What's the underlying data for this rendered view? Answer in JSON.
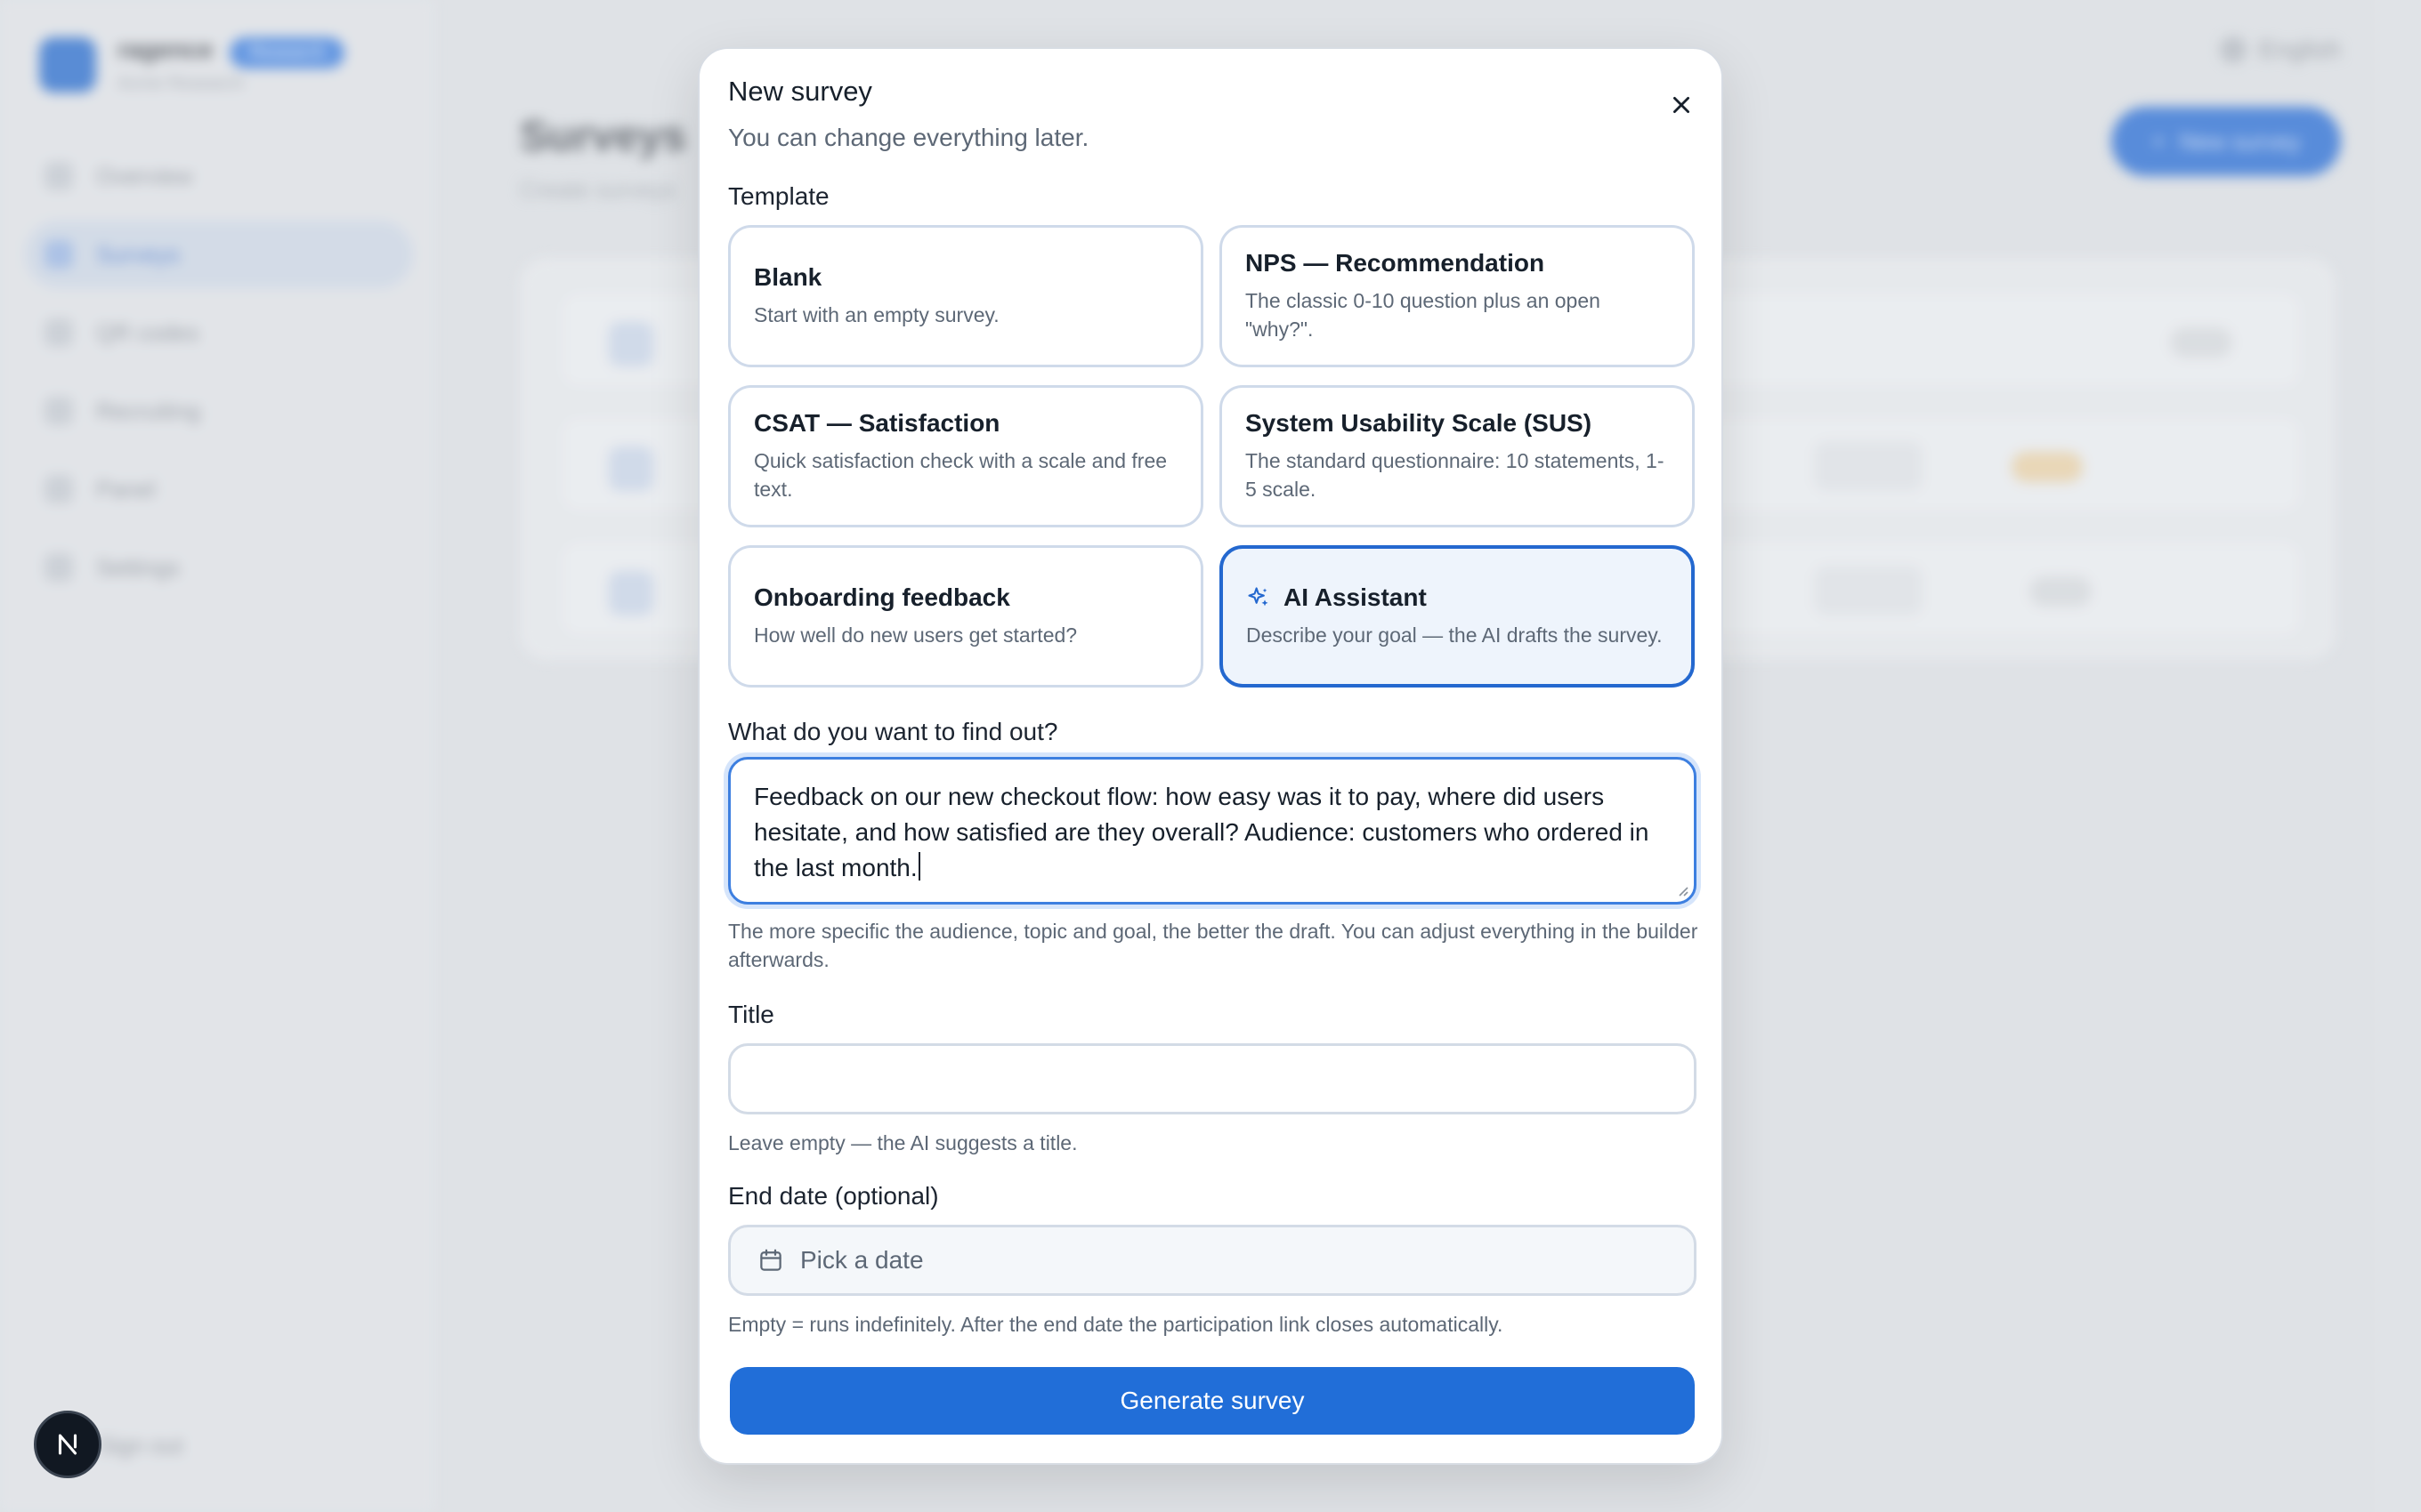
{
  "background": {
    "brand": {
      "name": "ragence",
      "badge": "Research",
      "sub": "Acme Research"
    },
    "nav": [
      {
        "label": "Overview",
        "active": false
      },
      {
        "label": "Surveys",
        "active": true
      },
      {
        "label": "QR codes",
        "active": false
      },
      {
        "label": "Recruiting",
        "active": false
      },
      {
        "label": "Panel",
        "active": false
      },
      {
        "label": "Settings",
        "active": false
      }
    ],
    "sign_out": "Sign out",
    "language": "English",
    "page_title": "Surveys",
    "page_sub": "Create surveys",
    "new_survey_button": "New survey"
  },
  "modal": {
    "title": "New survey",
    "subtitle": "You can change everything later.",
    "template_label": "Template",
    "templates": [
      {
        "name": "Blank",
        "description": "Start with an empty survey.",
        "selected": false
      },
      {
        "name": "NPS — Recommendation",
        "description": "The classic 0-10 question plus an open \"why?\".",
        "selected": false
      },
      {
        "name": "CSAT — Satisfaction",
        "description": "Quick satisfaction check with a scale and free text.",
        "selected": false
      },
      {
        "name": "System Usability Scale (SUS)",
        "description": "The standard questionnaire: 10 statements, 1-5 scale.",
        "selected": false
      },
      {
        "name": "Onboarding feedback",
        "description": "How well do new users get started?",
        "selected": false
      },
      {
        "name": "AI Assistant",
        "description": "Describe your goal — the AI drafts the survey.",
        "selected": true
      }
    ],
    "goal_label": "What do you want to find out?",
    "goal_value": "Feedback on our new checkout flow: how easy was it to pay, where did users hesitate, and how satisfied are they overall? Audience: customers who ordered in the last month.",
    "goal_help": "The more specific the audience, topic and goal, the better the draft. You can adjust everything in the builder afterwards.",
    "title_label": "Title",
    "title_value": "",
    "title_help": "Leave empty — the AI suggests a title.",
    "end_date_label": "End date (optional)",
    "end_date_placeholder": "Pick a date",
    "end_date_help": "Empty = runs indefinitely. After the end date the participation link closes automatically.",
    "generate_button": "Generate survey"
  },
  "colors": {
    "accent": "#216ed8",
    "selected_bg": "#eef4fc"
  },
  "icons": {
    "close": "close-icon",
    "ai": "sparkles-icon",
    "calendar": "calendar-icon",
    "dev": "nextjs-icon"
  }
}
